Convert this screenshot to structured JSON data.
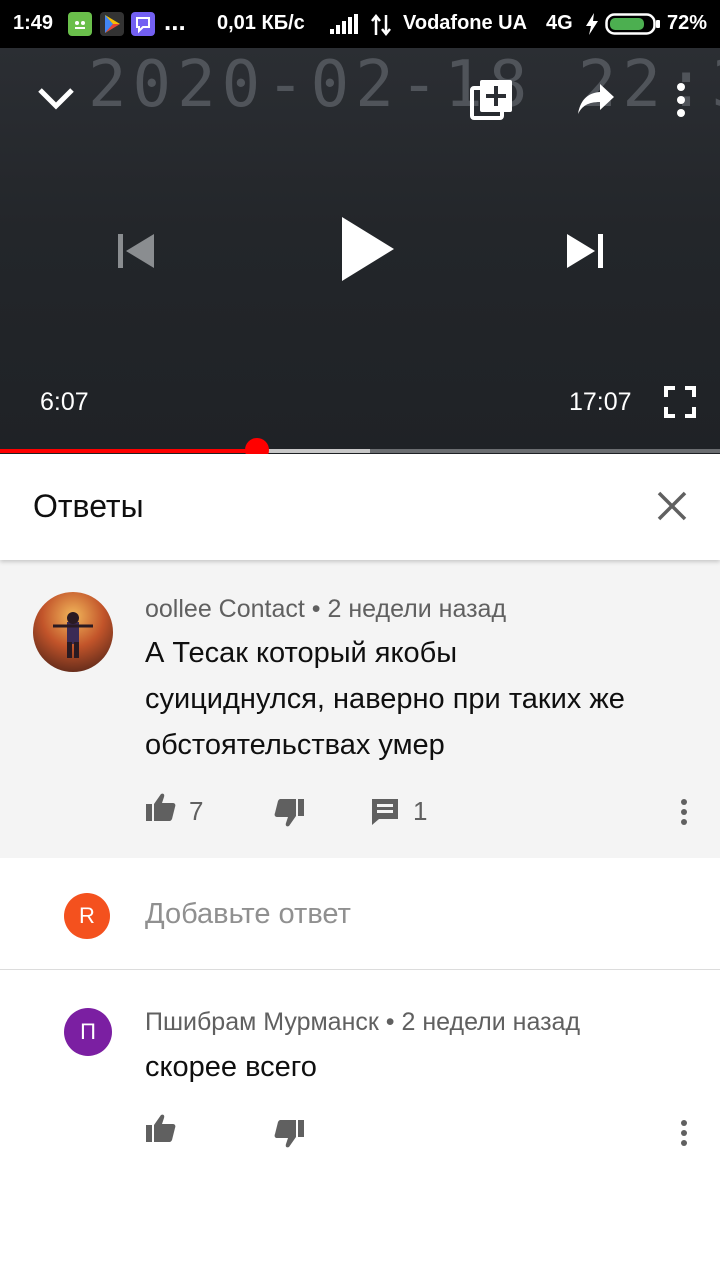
{
  "status_bar": {
    "time": "1:49",
    "speed": "0,01 КБ/с",
    "carrier": "Vodafone UA",
    "network": "4G",
    "battery": "72%",
    "dots": "...",
    "icons": [
      "notification-app-icon",
      "play-store-icon",
      "viber-icon",
      "signal-icon",
      "data-transfer-icon",
      "charging-icon",
      "battery-icon"
    ]
  },
  "player": {
    "watermark": "2020-02-18  22:3",
    "current_time": "6:07",
    "duration": "17:07",
    "played_fraction": 0.357,
    "buffered_fraction": 0.514,
    "icons": [
      "chevron-down-icon",
      "add-to-playlist-icon",
      "share-icon",
      "more-vert-icon",
      "previous-icon",
      "play-icon",
      "next-icon",
      "fullscreen-icon"
    ],
    "colors": {
      "progress_played": "#ff0000",
      "progress_buffered": "#c8c8c8"
    }
  },
  "panel": {
    "title": "Ответы",
    "close_icon": "close-icon"
  },
  "comment": {
    "author": "oollee Contact",
    "age": "2 недели назад",
    "separator": "•",
    "text_lines": [
      "А Тесак который якобы",
      "суициднулся, наверно при таких же",
      "обстоятельствах умер"
    ],
    "likes": "7",
    "replies": "1",
    "icons": [
      "like-icon",
      "dislike-icon",
      "reply-icon",
      "more-vert-icon"
    ]
  },
  "reply_box": {
    "avatar_letter": "R",
    "avatar_color": "#f4511e",
    "placeholder": "Добавьте ответ"
  },
  "reply": {
    "avatar_letter": "П",
    "avatar_color": "#7b1fa2",
    "author": "Пшибрам Мурманск",
    "age": "2 недели назад",
    "separator": "•",
    "text": "скорее всего",
    "icons": [
      "like-icon",
      "dislike-icon",
      "more-vert-icon"
    ]
  }
}
